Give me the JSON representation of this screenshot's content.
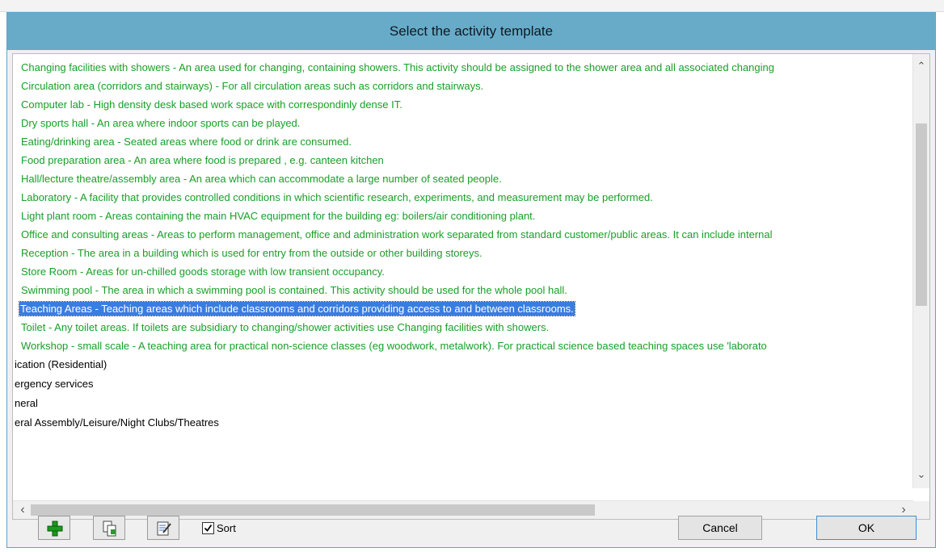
{
  "dialog": {
    "title": "Select the activity template"
  },
  "list": {
    "items": [
      {
        "text": "Changing facilities with showers - An area used for changing, containing showers. This activity should be assigned to the shower area and all associated changing"
      },
      {
        "text": "Circulation area (corridors and stairways) - For all circulation areas such as corridors and stairways."
      },
      {
        "text": "Computer lab - High density desk based work space with correspondinly dense IT."
      },
      {
        "text": "Dry sports hall - An area where indoor sports can be played."
      },
      {
        "text": "Eating/drinking area - Seated areas where food or drink are consumed."
      },
      {
        "text": "Food preparation area - An area where food is prepared , e.g. canteen kitchen"
      },
      {
        "text": "Hall/lecture theatre/assembly area - An area which can accommodate a large number of seated people."
      },
      {
        "text": "Laboratory - A facility that provides controlled conditions in which scientific research, experiments, and measurement may be performed."
      },
      {
        "text": "Light plant room - Areas containing the main HVAC equipment for the building eg: boilers/air conditioning plant."
      },
      {
        "text": "Office and consulting areas - Areas to perform management, office and administration work separated from standard customer/public areas. It can include internal"
      },
      {
        "text": "Reception - The area in a building which is used for entry from the outside or other building storeys."
      },
      {
        "text": "Store Room - Areas for un-chilled goods storage with low transient occupancy."
      },
      {
        "text": "Swimming pool - The area in which a swimming pool is contained. This activity should be used for the whole pool hall."
      },
      {
        "text": "Teaching Areas - Teaching areas which include classrooms and corridors providing access to and between classrooms."
      },
      {
        "text": "Toilet - Any toilet areas. If toilets are subsidiary to changing/shower activities use Changing facilities with showers."
      },
      {
        "text": "Workshop - small scale - A teaching area for practical non-science classes (eg woodwork, metalwork). For practical science based teaching spaces use 'laborato"
      }
    ],
    "categories": [
      {
        "text": "ication (Residential)"
      },
      {
        "text": "ergency services"
      },
      {
        "text": "neral"
      },
      {
        "text": "eral Assembly/Leisure/Night Clubs/Theatres"
      }
    ],
    "selected_index": 13
  },
  "toolbar": {
    "sort_label": "Sort",
    "sort_checked": true
  },
  "buttons": {
    "cancel_label": "Cancel",
    "ok_label": "OK"
  },
  "colors": {
    "title_bar": "#67abc9",
    "item_text": "#17a027",
    "selection": "#3a7de0"
  }
}
